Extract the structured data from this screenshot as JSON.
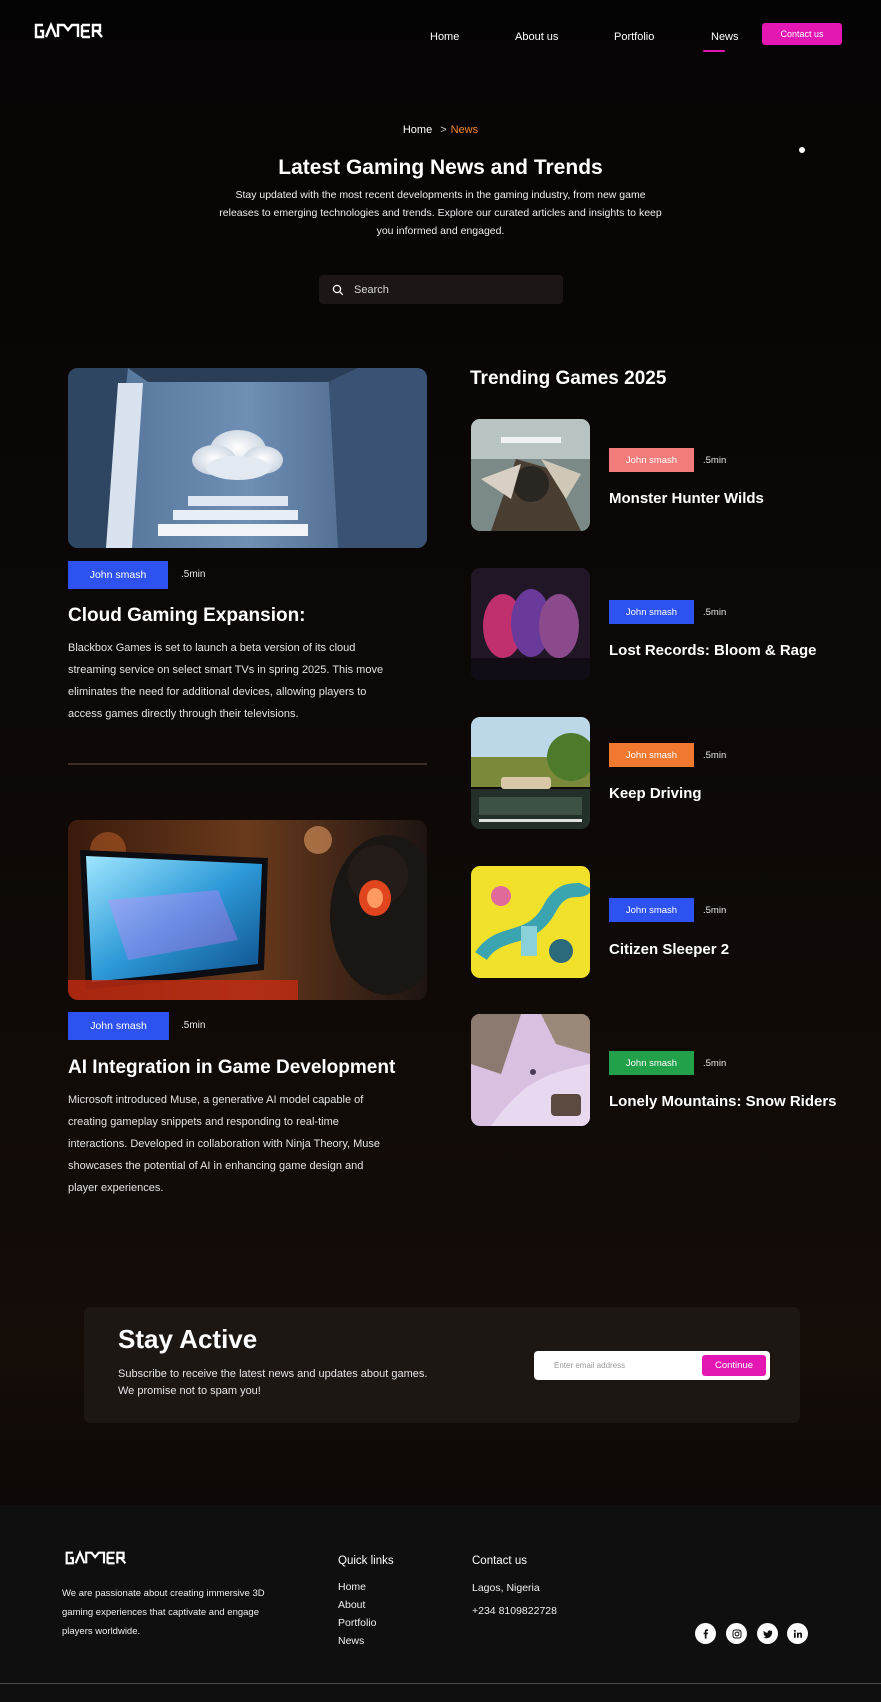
{
  "header": {
    "logo_text": "GAMER",
    "nav": [
      "Home",
      "About us",
      "Portfolio",
      "News"
    ],
    "active_nav": "News",
    "contact_label": "Contact us"
  },
  "breadcrumb": {
    "home": "Home",
    "separator": ">",
    "current": "News"
  },
  "hero": {
    "title": "Latest Gaming News and Trends",
    "description": "Stay updated with the most recent developments in the gaming industry, from new game releases to emerging technologies and trends. Explore our curated articles and insights to keep you informed and engaged."
  },
  "search": {
    "placeholder": "Search"
  },
  "articles": [
    {
      "author": "John smash",
      "read_time": ".5min",
      "title": "Cloud Gaming Expansion:",
      "body": "Blackbox Games is set to launch a beta version of its cloud streaming service on select smart TVs in spring 2025. This move eliminates the need for additional devices, allowing players to access games directly through their televisions."
    },
    {
      "author": "John smash",
      "read_time": ".5min",
      "title": "AI Integration in Game Development",
      "body": "Microsoft introduced Muse, a generative AI model capable of creating gameplay snippets and responding to real-time interactions. Developed in collaboration with Ninja Theory, Muse showcases the potential of AI in enhancing game design and player experiences."
    }
  ],
  "trending": {
    "title": "Trending Games 2025",
    "items": [
      {
        "author": "John smash",
        "read_time": ".5min",
        "name": "Monster Hunter Wilds",
        "badge_color": "#f27b7b"
      },
      {
        "author": "John smash",
        "read_time": ".5min",
        "name": "Lost Records: Bloom & Rage",
        "badge_color": "#2d52f0"
      },
      {
        "author": "John smash",
        "read_time": ".5min",
        "name": "Keep Driving",
        "badge_color": "#f0782f"
      },
      {
        "author": "John smash",
        "read_time": ".5min",
        "name": "Citizen Sleeper 2",
        "badge_color": "#2d52f0"
      },
      {
        "author": "John smash",
        "read_time": ".5min",
        "name": "Lonely Mountains: Snow Riders",
        "badge_color": "#22a04a"
      }
    ]
  },
  "newsletter": {
    "title": "Stay Active",
    "line1": "Subscribe to receive the latest news and updates about games.",
    "line2": "We promise not to spam you!",
    "email_placeholder": "Enter email address",
    "button": "Continue"
  },
  "footer": {
    "about": "We are passionate about creating immersive 3D gaming experiences that captivate and engage players worldwide.",
    "quick_links_title": "Quick links",
    "quick_links": [
      "Home",
      "About",
      "Portfolio",
      "News"
    ],
    "contact_title": "Contact us",
    "location": "Lagos, Nigeria",
    "phone": "+234 8109822728",
    "socials": [
      "facebook-icon",
      "instagram-icon",
      "twitter-icon",
      "linkedin-icon"
    ]
  },
  "colors": {
    "accent_pink": "#e417b3",
    "accent_orange": "#f0872c",
    "badge_blue": "#2d52f0"
  }
}
